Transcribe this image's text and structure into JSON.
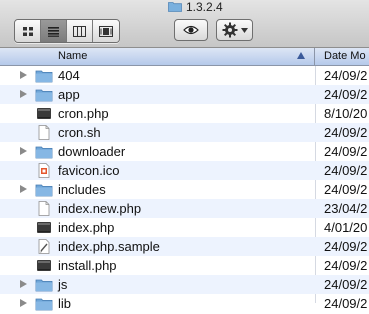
{
  "window": {
    "title": "1.3.2.4"
  },
  "toolbar": {
    "views": [
      {
        "name": "icon-view",
        "active": false
      },
      {
        "name": "list-view",
        "active": true
      },
      {
        "name": "column-view",
        "active": false
      },
      {
        "name": "coverflow-view",
        "active": false
      }
    ],
    "quicklook_icon": "eye-icon",
    "action_icon": "gear-icon"
  },
  "columns": {
    "name": "Name",
    "date": "Date Mo"
  },
  "files": [
    {
      "name": "404",
      "type": "folder",
      "date": "24/09/2",
      "expandable": true
    },
    {
      "name": "app",
      "type": "folder",
      "date": "24/09/2",
      "expandable": true
    },
    {
      "name": "cron.php",
      "type": "php",
      "date": "8/10/20",
      "expandable": false
    },
    {
      "name": "cron.sh",
      "type": "doc",
      "date": "24/09/2",
      "expandable": false
    },
    {
      "name": "downloader",
      "type": "folder",
      "date": "24/09/2",
      "expandable": true
    },
    {
      "name": "favicon.ico",
      "type": "ico",
      "date": "24/09/2",
      "expandable": false
    },
    {
      "name": "includes",
      "type": "folder",
      "date": "24/09/2",
      "expandable": true
    },
    {
      "name": "index.new.php",
      "type": "doc",
      "date": "23/04/2",
      "expandable": false
    },
    {
      "name": "index.php",
      "type": "php",
      "date": "4/01/20",
      "expandable": false
    },
    {
      "name": "index.php.sample",
      "type": "sample",
      "date": "24/09/2",
      "expandable": false
    },
    {
      "name": "install.php",
      "type": "php",
      "date": "24/09/2",
      "expandable": false
    },
    {
      "name": "js",
      "type": "folder",
      "date": "24/09/2",
      "expandable": true
    },
    {
      "name": "lib",
      "type": "folder",
      "date": "24/09/2",
      "expandable": true
    }
  ]
}
